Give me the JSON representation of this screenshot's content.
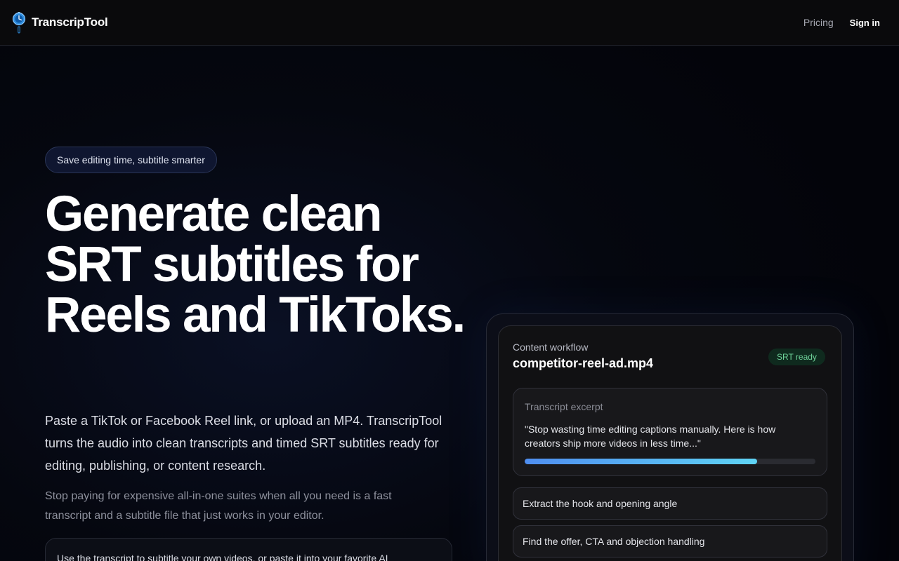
{
  "header": {
    "brand": "TranscripTool",
    "nav": {
      "pricing": "Pricing",
      "signin": "Sign in"
    }
  },
  "hero": {
    "badge": "Save editing time, subtitle smarter",
    "headline": "Generate clean SRT subtitles for Reels and TikToks.",
    "lead": "Paste a TikTok or Facebook Reel link, or upload an MP4. TranscripTool turns the audio into clean transcripts and timed SRT subtitles ready for editing, publishing, or content research.",
    "sub": "Stop paying for expensive all-in-one suites when all you need is a fast transcript and a subtitle file that just works in your editor.",
    "note": "Use the transcript to subtitle your own videos, or paste it into your favorite AI"
  },
  "workflow": {
    "label": "Content workflow",
    "file": "competitor-reel-ad.mp4",
    "status": "SRT ready",
    "excerpt_label": "Transcript excerpt",
    "excerpt_text": "\"Stop wasting time editing captions manually. Here is how creators ship more videos in less time...\"",
    "progress": 0.8,
    "tasks": [
      "Extract the hook and opening angle",
      "Find the offer, CTA and objection handling"
    ]
  },
  "colors": {
    "accent_blue": "#4f8ef0",
    "accent_cyan": "#5fd4f5",
    "success_green": "#6fd39a",
    "background": "#03040c"
  },
  "icons": {
    "logo": "stopwatch-pin-icon"
  }
}
